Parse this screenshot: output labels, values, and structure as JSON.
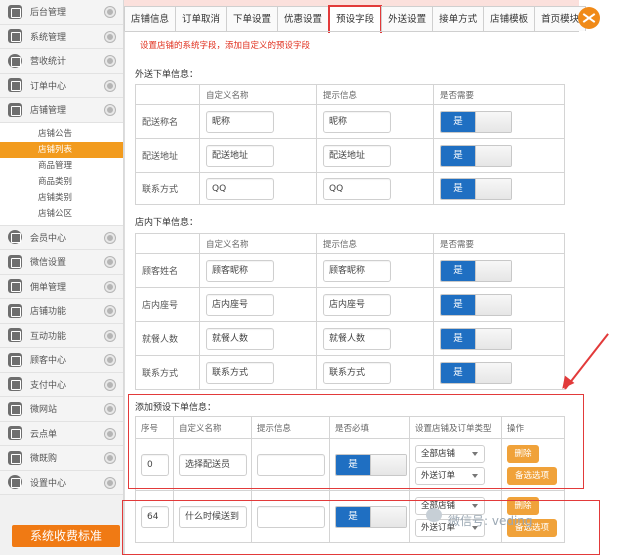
{
  "sidebar": {
    "items": [
      {
        "label": "后台管理",
        "icon": "grid-icon"
      },
      {
        "label": "系统管理",
        "icon": "grid-icon"
      },
      {
        "label": "营收统计",
        "icon": "clock-icon"
      },
      {
        "label": "订单中心",
        "icon": "order-icon"
      },
      {
        "label": "店铺管理",
        "icon": "store-icon"
      }
    ],
    "sub_items": [
      "店铺公告",
      "店铺列表",
      "商品管理",
      "商品类别",
      "店铺类别",
      "店铺公区"
    ],
    "items_bottom": [
      {
        "label": "会员中心",
        "icon": "member-icon"
      },
      {
        "label": "微信设置",
        "icon": "wechat-icon"
      },
      {
        "label": "佣单管理",
        "icon": "order-icon"
      },
      {
        "label": "店铺功能",
        "icon": "plus-icon"
      },
      {
        "label": "互动功能",
        "icon": "plus-icon"
      },
      {
        "label": "顾客中心",
        "icon": "customer-icon"
      },
      {
        "label": "支付中心",
        "icon": "pay-icon"
      },
      {
        "label": "微网站",
        "icon": "site-icon"
      },
      {
        "label": "云点单",
        "icon": "cloud-icon"
      },
      {
        "label": "微既购",
        "icon": "cart-icon"
      },
      {
        "label": "设置中心",
        "icon": "settings-icon"
      }
    ],
    "cta": "系统收费标准"
  },
  "tabs": [
    "店铺信息",
    "订单取消",
    "下单设置",
    "优惠设置",
    "预设字段",
    "外送设置",
    "接单方式",
    "店铺模板",
    "首页模块"
  ],
  "hint": "设置店铺的系统字段，添加自定义的预设字段",
  "delivery": {
    "title": "外送下单信息：",
    "headers": [
      "自定义名称",
      "提示信息",
      "是否需要"
    ],
    "rows": [
      {
        "label": "配送称名",
        "name": "昵称",
        "tip": "昵称",
        "toggle": "是"
      },
      {
        "label": "配送地址",
        "name": "配送地址",
        "tip": "配送地址",
        "toggle": "是"
      },
      {
        "label": "联系方式",
        "name": "QQ",
        "tip": "QQ",
        "toggle": "是"
      }
    ]
  },
  "dinein": {
    "title": "店内下单信息：",
    "headers": [
      "自定义名称",
      "提示信息",
      "是否需要"
    ],
    "rows": [
      {
        "label": "顾客姓名",
        "name": "顾客昵称",
        "tip": "顾客昵称",
        "toggle": "是"
      },
      {
        "label": "店内座号",
        "name": "店内座号",
        "tip": "店内座号",
        "toggle": "是"
      },
      {
        "label": "就餐人数",
        "name": "就餐人数",
        "tip": "就餐人数",
        "toggle": "是"
      },
      {
        "label": "联系方式",
        "name": "联系方式",
        "tip": "联系方式",
        "toggle": "是"
      }
    ]
  },
  "preset": {
    "title": "添加预设下单信息：",
    "headers": [
      "序号",
      "自定义名称",
      "提示信息",
      "是否必填",
      "设置店铺及订单类型",
      "操作"
    ],
    "rows": [
      {
        "seq": "0",
        "name": "选择配送员",
        "tip": "",
        "toggle": "是",
        "store": "全部店铺",
        "order": "外送订单",
        "delete": "删除",
        "options": "备选选项"
      },
      {
        "seq": "64",
        "name": "什么时候送到",
        "tip": "",
        "toggle": "是",
        "store": "全部店铺",
        "order": "外送订单",
        "delete": "删除",
        "options": "备选选项"
      }
    ]
  },
  "watermark": "微信号: veding"
}
